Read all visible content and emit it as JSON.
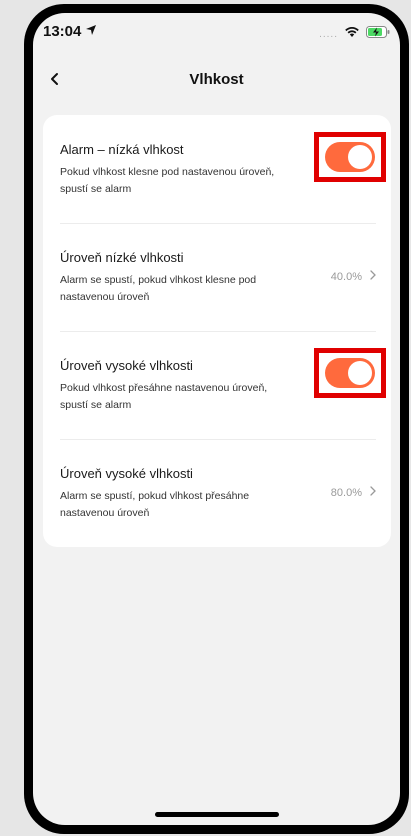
{
  "status_bar": {
    "time": "13:04",
    "signal": "....."
  },
  "header": {
    "title": "Vlhkost"
  },
  "settings": [
    {
      "title": "Alarm – nízká vlhkost",
      "description": "Pokud vlhkost klesne pod nastavenou úroveň, spustí se alarm",
      "type": "toggle",
      "enabled": true
    },
    {
      "title": "Úroveň nízké vlhkosti",
      "description": "Alarm se spustí, pokud vlhkost klesne pod nastavenou úroveň",
      "type": "value",
      "value": "40.0%"
    },
    {
      "title": "Úroveň vysoké vlhkosti",
      "description": "Pokud vlhkost přesáhne nastavenou úroveň, spustí se alarm",
      "type": "toggle",
      "enabled": true
    },
    {
      "title": "Úroveň vysoké vlhkosti",
      "description": "Alarm se spustí, pokud vlhkost přesáhne nastavenou úroveň",
      "type": "value",
      "value": "80.0%"
    }
  ],
  "colors": {
    "accent": "#ff6a3d",
    "highlight": "#e00000"
  }
}
